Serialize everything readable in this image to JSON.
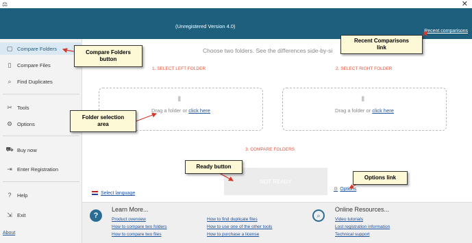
{
  "window": {
    "version": "(Unregistered Version 4.0)",
    "recent_link": "Recent comparisons",
    "close_glyph": "✕",
    "app_icon": "⚖"
  },
  "sidebar": {
    "items": [
      {
        "label": "Compare Folders",
        "icon": "folder-icon",
        "glyph": "▢"
      },
      {
        "label": "Compare Files",
        "icon": "file-icon",
        "glyph": "▯"
      },
      {
        "label": "Find Duplicates",
        "icon": "search-icon",
        "glyph": "⌕"
      },
      {
        "label": "Tools",
        "icon": "tools-icon",
        "glyph": "✂"
      },
      {
        "label": "Options",
        "icon": "gear-icon",
        "glyph": "⚙"
      },
      {
        "label": "Buy now",
        "icon": "cart-icon",
        "glyph": "⛟"
      },
      {
        "label": "Enter Registration",
        "icon": "login-icon",
        "glyph": "⇥"
      },
      {
        "label": "Help",
        "icon": "help-icon",
        "glyph": "?"
      },
      {
        "label": "Exit",
        "icon": "exit-icon",
        "glyph": "⇲"
      }
    ],
    "about": "About"
  },
  "main": {
    "intro": "Choose two folders. See the differences side-by-si",
    "left_step": "1. SELECT LEFT FOLDER",
    "right_step": "2. SELECT RIGHT FOLDER",
    "drop_text": "Drag a folder or",
    "drop_link": "click here",
    "compare_step": "3. COMPARE FOLDERS",
    "ready_button": "NOT READY",
    "options_link": "Options",
    "language_link": "Select language"
  },
  "footer": {
    "learn_title": "Learn More...",
    "learn_links_col1": [
      "Product overview",
      "How to compare two folders",
      "How to compare two files"
    ],
    "learn_links_col2": [
      "How to find duplicate files",
      "How to use one of the other tools",
      "How to purchase a license"
    ],
    "online_title": "Online Resources...",
    "online_links": [
      "Video tutorials",
      "Lost registration information",
      "Technical support"
    ]
  },
  "callouts": {
    "compare_folders": "Compare Folders\nbutton",
    "recent": "Recent Comparisons\nlink",
    "folder_selection": "Folder selection\narea",
    "ready": "Ready button",
    "options": "Options link"
  },
  "colors": {
    "header": "#1f5f7e",
    "accent_step": "#e1553d",
    "link": "#1a4f9c",
    "callout_bg": "#fdf8d6",
    "arrow": "#d33a2a"
  }
}
